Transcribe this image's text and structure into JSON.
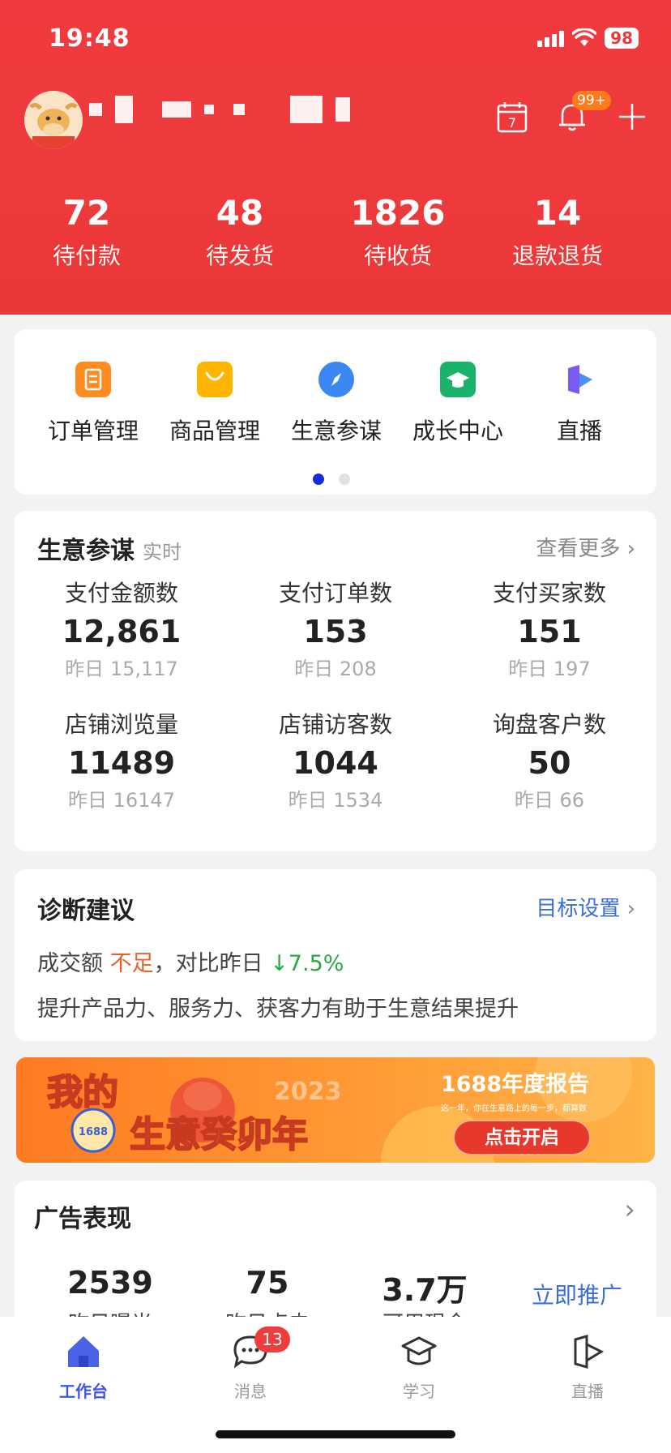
{
  "status_bar": {
    "time": "19:48",
    "battery": "98"
  },
  "header": {
    "calendar_day": "7",
    "notification_badge": "99+",
    "stats": [
      {
        "value": "72",
        "label": "待付款"
      },
      {
        "value": "48",
        "label": "待发货"
      },
      {
        "value": "1826",
        "label": "待收货"
      },
      {
        "value": "14",
        "label": "退款退货"
      }
    ]
  },
  "quick_menu": {
    "items": [
      {
        "label": "订单管理",
        "color": "#ff8a1f"
      },
      {
        "label": "商品管理",
        "color": "#ffb400"
      },
      {
        "label": "生意参谋",
        "color": "#3a86f2"
      },
      {
        "label": "成长中心",
        "color": "#19b36b"
      },
      {
        "label": "直播",
        "color": "#6b5cf0"
      }
    ],
    "page_dots_active": 1,
    "page_dots_total": 2
  },
  "business": {
    "title": "生意参谋",
    "subtitle": "实时",
    "more": "查看更多",
    "metrics": [
      {
        "label": "支付金额数",
        "value": "12,861",
        "yesterday": "昨日 15,117"
      },
      {
        "label": "支付订单数",
        "value": "153",
        "yesterday": "昨日 208"
      },
      {
        "label": "支付买家数",
        "value": "151",
        "yesterday": "昨日 197"
      },
      {
        "label": "店铺浏览量",
        "value": "11489",
        "yesterday": "昨日 16147"
      },
      {
        "label": "店铺访客数",
        "value": "1044",
        "yesterday": "昨日 1534"
      },
      {
        "label": "询盘客户数",
        "value": "50",
        "yesterday": "昨日 66"
      }
    ]
  },
  "diagnosis": {
    "title": "诊断建议",
    "link": "目标设置",
    "line1_prefix": "成交额",
    "line1_status": "不足",
    "line1_compare": "，对比昨日",
    "line1_change": "↓7.5%",
    "line2": "提升产品力、服务力、获客力有助于生意结果提升"
  },
  "banner": {
    "title_a": "我的",
    "title_b": "生意癸卯年",
    "year": "2023",
    "report": "1688年度报告",
    "tagline": "这一年，你在生意路上的每一步，都算数",
    "button": "点击开启",
    "seal": "1688"
  },
  "ads": {
    "title": "广告表现",
    "stats": [
      {
        "value": "2539",
        "label": "昨日曝光"
      },
      {
        "value": "75",
        "label": "昨日点击"
      },
      {
        "value": "3.7万",
        "label": "可用现金"
      }
    ],
    "promote": "立即推广"
  },
  "tabbar": {
    "items": [
      {
        "label": "工作台"
      },
      {
        "label": "消息",
        "badge": "13"
      },
      {
        "label": "学习"
      },
      {
        "label": "直播"
      }
    ]
  }
}
